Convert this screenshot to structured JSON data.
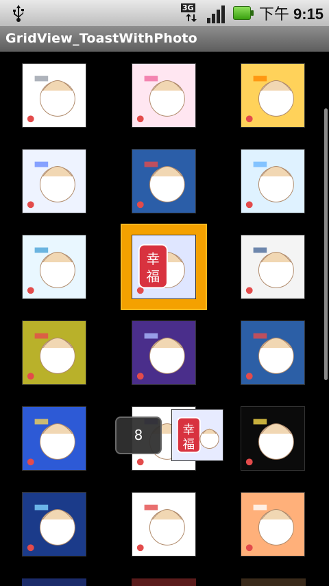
{
  "status": {
    "time_prefix": "下午",
    "time": "9:15",
    "network": "3G"
  },
  "title": "GridView_ToastWithPhoto",
  "toast": {
    "text": "8"
  },
  "selected_index": 7,
  "grid_items": [
    {
      "name": "grid-item-1",
      "bg": "#ffffff",
      "accent": "#9aa0aa"
    },
    {
      "name": "grid-item-2",
      "bg": "#ffe6f1",
      "accent": "#f06aa0"
    },
    {
      "name": "grid-item-3",
      "bg": "#ffd25a",
      "accent": "#ff8a00"
    },
    {
      "name": "grid-item-4",
      "bg": "#eef3ff",
      "accent": "#6b8cff"
    },
    {
      "name": "grid-item-5",
      "bg": "#2b5ea8",
      "accent": "#e34b4b"
    },
    {
      "name": "grid-item-6",
      "bg": "#dff2ff",
      "accent": "#6bb6ff"
    },
    {
      "name": "grid-item-7",
      "bg": "#e9f7ff",
      "accent": "#4aa3d8"
    },
    {
      "name": "grid-item-8",
      "bg": "#dfe6ff",
      "accent": "#d8323f"
    },
    {
      "name": "grid-item-9",
      "bg": "#f4f4f4",
      "accent": "#4b6a9a"
    },
    {
      "name": "grid-item-10",
      "bg": "#b9b12a",
      "accent": "#e34b4b"
    },
    {
      "name": "grid-item-11",
      "bg": "#4a2e8b",
      "accent": "#aab9ff"
    },
    {
      "name": "grid-item-12",
      "bg": "#2c5fa6",
      "accent": "#e34b4b"
    },
    {
      "name": "grid-item-13",
      "bg": "#2d5ad6",
      "accent": "#f2d25a"
    },
    {
      "name": "grid-item-14",
      "bg": "#ffffff",
      "accent": "#5a3cff"
    },
    {
      "name": "grid-item-15",
      "bg": "#0b0b0b",
      "accent": "#f6d84a"
    },
    {
      "name": "grid-item-16",
      "bg": "#1b3b8a",
      "accent": "#7fd3ff"
    },
    {
      "name": "grid-item-17",
      "bg": "#ffffff",
      "accent": "#e34b4b"
    },
    {
      "name": "grid-item-18",
      "bg": "#ffb07a",
      "accent": "#ffffff"
    }
  ]
}
